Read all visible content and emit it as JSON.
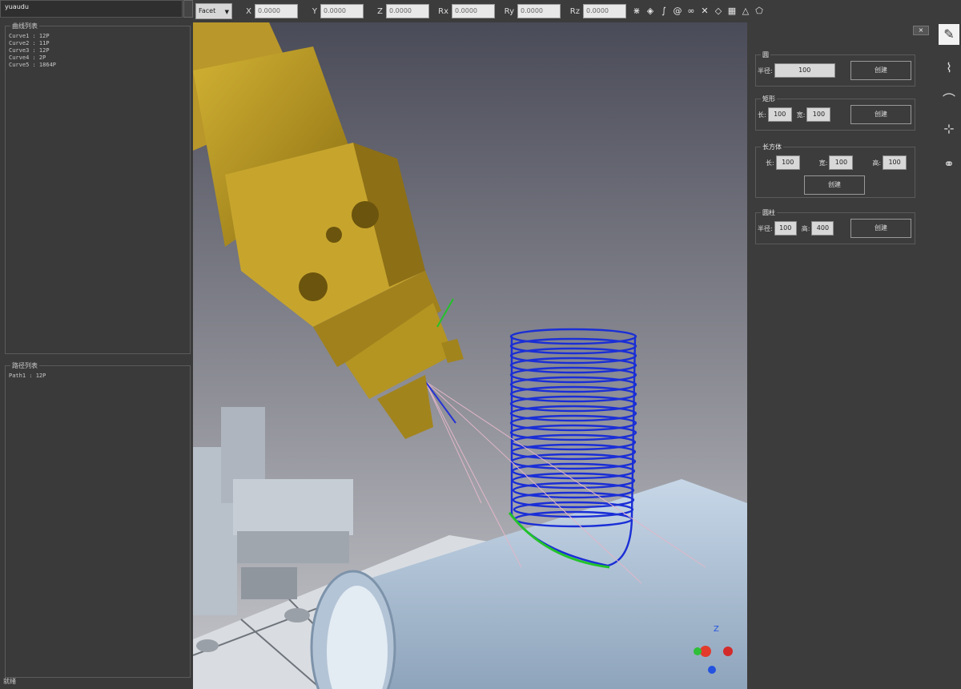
{
  "window": {
    "title": "yuaudu"
  },
  "toolbar": {
    "frame_select": "Facet",
    "coords": [
      {
        "label": "X",
        "value": "0.0000"
      },
      {
        "label": "Y",
        "value": "0.0000"
      },
      {
        "label": "Z",
        "value": "0.0000"
      },
      {
        "label": "Rx",
        "value": "0.0000"
      },
      {
        "label": "Ry",
        "value": "0.0000"
      },
      {
        "label": "Rz",
        "value": "0.0000"
      }
    ],
    "icons": [
      "axes-icon",
      "diamond-icon",
      "curve-icon",
      "spiral-icon",
      "knot-icon",
      "cross-icon",
      "diamond-small-icon",
      "grid-icon",
      "triangle-icon",
      "shapes-icon"
    ]
  },
  "left_panel": {
    "curve_list": {
      "title": "曲线列表",
      "items": [
        "Curve1 : 12P",
        "Curve2 : 11P",
        "Curve3 : 12P",
        "Curve4 : 2P",
        "Curve5 : 1864P"
      ]
    },
    "path_list": {
      "title": "路径列表",
      "items": [
        "Path1 : 12P"
      ]
    },
    "status": "就绪"
  },
  "right_panel": {
    "close_label": "×",
    "groups": [
      {
        "title": "圆",
        "rows": [
          {
            "label": "半径:",
            "value": "100"
          }
        ],
        "button": "创建"
      },
      {
        "title": "矩形",
        "rows": [
          {
            "label": "长:",
            "value": "100"
          },
          {
            "label": "宽:",
            "value": "100"
          }
        ],
        "button": "创建"
      },
      {
        "title": "长方体",
        "rows": [
          {
            "label": "长:",
            "value": "100"
          },
          {
            "label": "宽:",
            "value": "100"
          },
          {
            "label": "高:",
            "value": "100"
          }
        ],
        "button": "创建"
      },
      {
        "title": "圆柱",
        "rows": [
          {
            "label": "半径:",
            "value": "100"
          },
          {
            "label": "高:",
            "value": "400"
          }
        ],
        "button": "创建"
      }
    ]
  },
  "side_tools": [
    "pen-tool-icon",
    "curve-edit-icon",
    "surface-curve-icon",
    "sketch-point-icon",
    "link-icon"
  ],
  "viewport": {
    "axis_label": "Z"
  }
}
